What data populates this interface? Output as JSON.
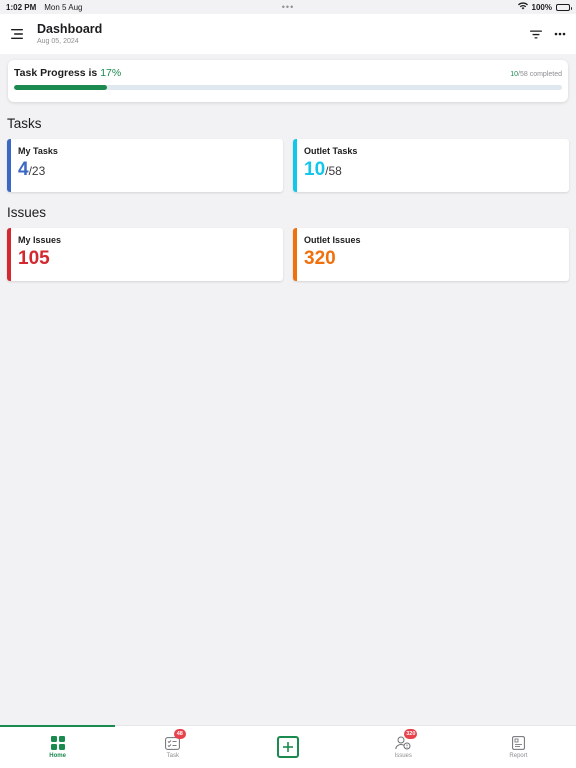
{
  "status_bar": {
    "time": "1:02 PM",
    "date": "Mon 5 Aug",
    "dots": "•••",
    "battery": "100%"
  },
  "header": {
    "title": "Dashboard",
    "date": "Aug 05, 2024"
  },
  "progress": {
    "title_prefix": "Task Progress is ",
    "percent_text": "17%",
    "completed": "10",
    "total_text": "/58 completed",
    "fraction": 0.17,
    "accent": "#1b8a4e"
  },
  "sections": {
    "tasks": "Tasks",
    "issues": "Issues"
  },
  "cards": {
    "my_tasks": {
      "label": "My Tasks",
      "value": "4",
      "total": "/23",
      "color": "#3a68c2"
    },
    "outlet_tasks": {
      "label": "Outlet Tasks",
      "value": "10",
      "total": "/58",
      "color": "#12c7ec"
    },
    "my_issues": {
      "label": "My Issues",
      "value": "105",
      "color": "#d3282f"
    },
    "outlet_issues": {
      "label": "Outlet Issues",
      "value": "320",
      "color": "#f0700e"
    }
  },
  "tabbar": {
    "tabs": [
      {
        "label": "Home",
        "icon": "grid-icon",
        "active": true
      },
      {
        "label": "Task",
        "icon": "task-list-icon",
        "badge": "48"
      },
      {
        "label": "",
        "icon": "plus-square-icon"
      },
      {
        "label": "Issues",
        "icon": "issues-user-icon",
        "badge": "320"
      },
      {
        "label": "Report",
        "icon": "report-icon"
      }
    ]
  }
}
